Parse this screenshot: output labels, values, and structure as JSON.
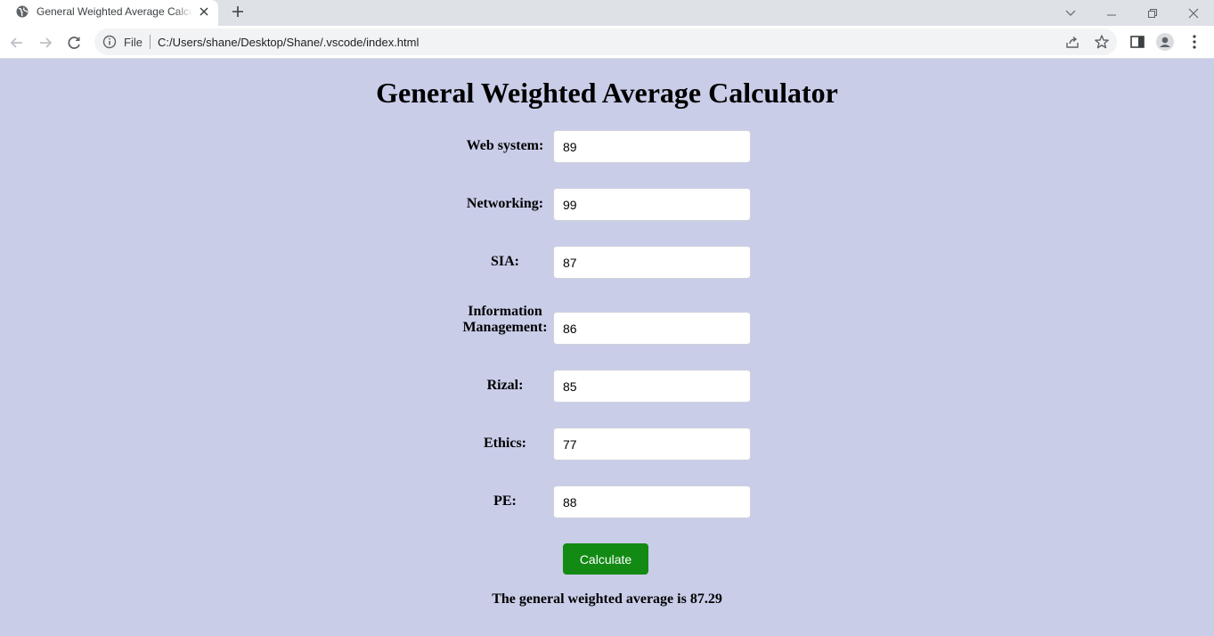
{
  "browser": {
    "tab_title": "General Weighted Average Calculator",
    "address_scheme": "File",
    "address_url": "C:/Users/shane/Desktop/Shane/.vscode/index.html"
  },
  "page": {
    "title": "General Weighted Average Calculator",
    "fields": [
      {
        "label": "Web system:",
        "value": "89"
      },
      {
        "label": "Networking:",
        "value": "99"
      },
      {
        "label": "SIA:",
        "value": "87"
      },
      {
        "label": "Information Management:",
        "value": "86"
      },
      {
        "label": "Rizal:",
        "value": "85"
      },
      {
        "label": "Ethics:",
        "value": "77"
      },
      {
        "label": "PE:",
        "value": "88"
      }
    ],
    "button_label": "Calculate",
    "result_text": "The general weighted average is 87.29"
  },
  "colors": {
    "page_background": "#c9cde8",
    "button_background": "#138a14",
    "button_text": "#ffffff"
  }
}
